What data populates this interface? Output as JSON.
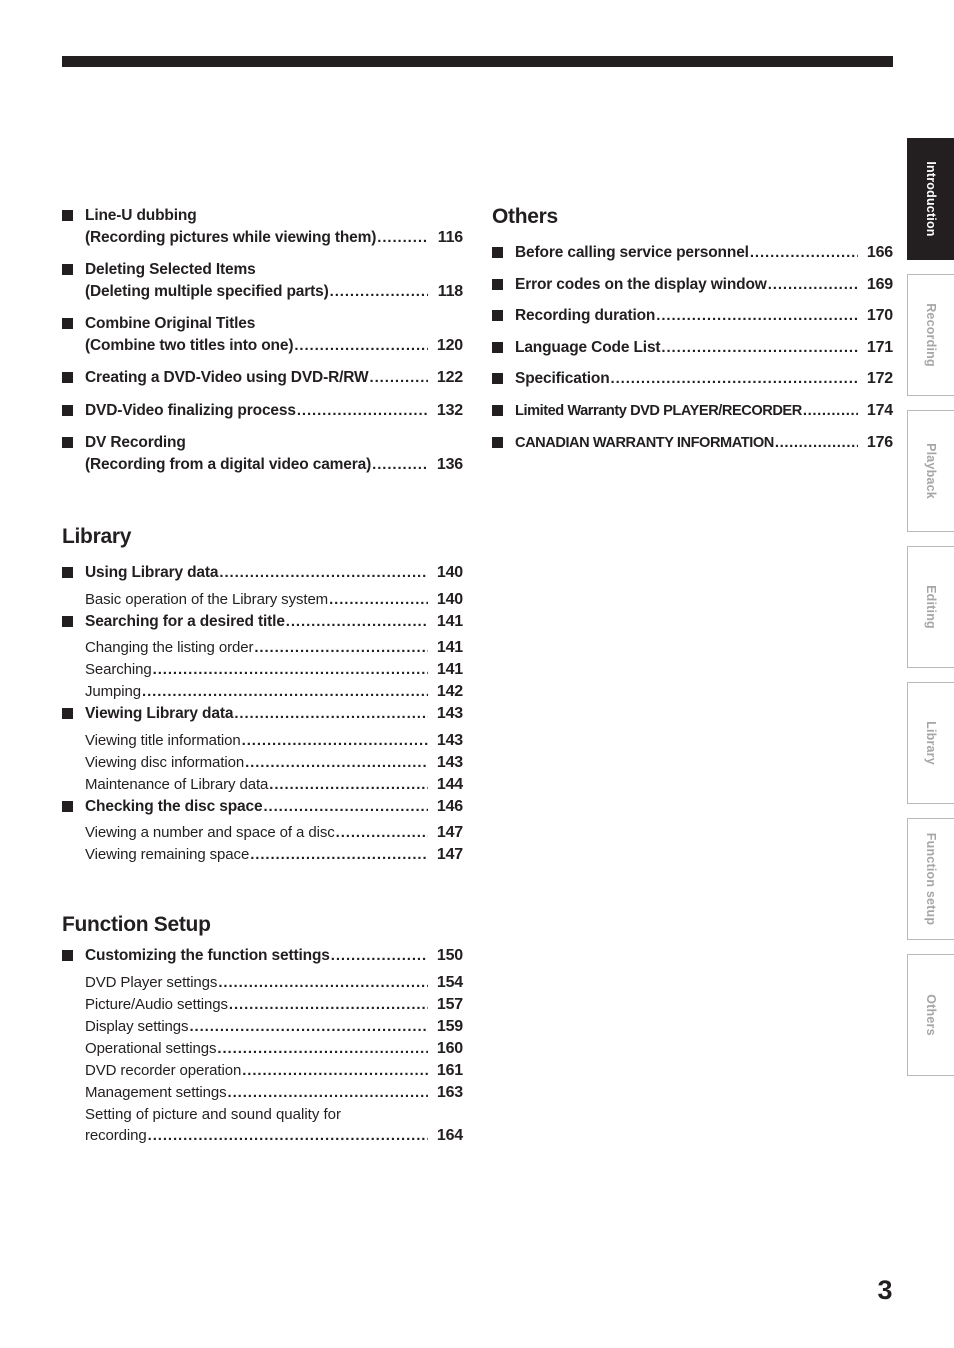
{
  "page": {
    "number": "3"
  },
  "left_column": {
    "recording_continued": {
      "entries": [
        {
          "type": "major",
          "lines": [
            "Line-U dubbing",
            "(Recording pictures while viewing them)"
          ],
          "page": "116"
        },
        {
          "type": "major",
          "lines": [
            "Deleting Selected Items",
            "(Deleting multiple specified parts)"
          ],
          "page": "118"
        },
        {
          "type": "major",
          "lines": [
            "Combine Original Titles",
            "(Combine two titles into one)"
          ],
          "page": "120"
        },
        {
          "type": "major",
          "lines": [
            "Creating a DVD-Video using DVD-R/RW"
          ],
          "page": "122"
        },
        {
          "type": "major",
          "lines": [
            "DVD-Video finalizing process"
          ],
          "page": "132"
        },
        {
          "type": "major",
          "lines": [
            "DV Recording",
            "(Recording from a digital video camera)"
          ],
          "page": "136"
        }
      ]
    },
    "library": {
      "heading": "Library",
      "entries": [
        {
          "type": "major",
          "lines": [
            "Using Library data"
          ],
          "page": "140"
        },
        {
          "type": "sub",
          "lines": [
            "Basic operation of the Library system"
          ],
          "page": "140"
        },
        {
          "type": "major",
          "lines": [
            "Searching for a desired title"
          ],
          "page": "141"
        },
        {
          "type": "sub",
          "lines": [
            "Changing the listing order"
          ],
          "page": "141"
        },
        {
          "type": "sub",
          "lines": [
            "Searching"
          ],
          "page": "141"
        },
        {
          "type": "sub",
          "lines": [
            "Jumping"
          ],
          "page": "142"
        },
        {
          "type": "major",
          "lines": [
            "Viewing Library data"
          ],
          "page": "143"
        },
        {
          "type": "sub",
          "lines": [
            "Viewing title information"
          ],
          "page": "143"
        },
        {
          "type": "sub",
          "lines": [
            "Viewing disc information"
          ],
          "page": "143"
        },
        {
          "type": "sub",
          "lines": [
            "Maintenance of Library data"
          ],
          "page": "144"
        },
        {
          "type": "major",
          "lines": [
            "Checking the disc space"
          ],
          "page": "146"
        },
        {
          "type": "sub",
          "lines": [
            "Viewing a number and space of a disc"
          ],
          "page": "147"
        },
        {
          "type": "sub",
          "lines": [
            "Viewing remaining space"
          ],
          "page": "147"
        }
      ]
    },
    "function_setup": {
      "heading": "Function Setup",
      "entries": [
        {
          "type": "major",
          "lines": [
            "Customizing the function settings"
          ],
          "page": "150"
        },
        {
          "type": "sub",
          "lines": [
            "DVD Player settings"
          ],
          "page": "154"
        },
        {
          "type": "sub",
          "lines": [
            "Picture/Audio settings"
          ],
          "page": "157"
        },
        {
          "type": "sub",
          "lines": [
            "Display settings"
          ],
          "page": "159"
        },
        {
          "type": "sub",
          "lines": [
            "Operational settings"
          ],
          "page": "160"
        },
        {
          "type": "sub",
          "lines": [
            "DVD recorder operation"
          ],
          "page": "161"
        },
        {
          "type": "sub",
          "lines": [
            "Management settings"
          ],
          "page": "163"
        },
        {
          "type": "sub",
          "lines": [
            "Setting of picture and sound quality for",
            "recording"
          ],
          "page": "164"
        }
      ]
    }
  },
  "right_column": {
    "others": {
      "heading": "Others",
      "entries": [
        {
          "type": "major",
          "lines": [
            "Before calling service personnel"
          ],
          "page": "166"
        },
        {
          "type": "major",
          "lines": [
            "Error codes on the display window"
          ],
          "page": "169"
        },
        {
          "type": "major",
          "lines": [
            "Recording duration"
          ],
          "page": "170"
        },
        {
          "type": "major",
          "lines": [
            "Language Code List"
          ],
          "page": "171"
        },
        {
          "type": "major",
          "lines": [
            "Specification"
          ],
          "page": "172"
        },
        {
          "type": "major",
          "condensed": true,
          "lines": [
            "Limited Warranty DVD PLAYER/RECORDER"
          ],
          "page": "174"
        },
        {
          "type": "major",
          "condensed": true,
          "lines": [
            "CANADIAN WARRANTY INFORMATION"
          ],
          "page": "176"
        }
      ]
    }
  },
  "side_tabs": [
    {
      "label": "Introduction",
      "active": true
    },
    {
      "label": "Recording",
      "active": false
    },
    {
      "label": "Playback",
      "active": false
    },
    {
      "label": "Editing",
      "active": false
    },
    {
      "label": "Library",
      "active": false
    },
    {
      "label": "Function setup",
      "active": false
    },
    {
      "label": "Others",
      "active": false
    }
  ]
}
